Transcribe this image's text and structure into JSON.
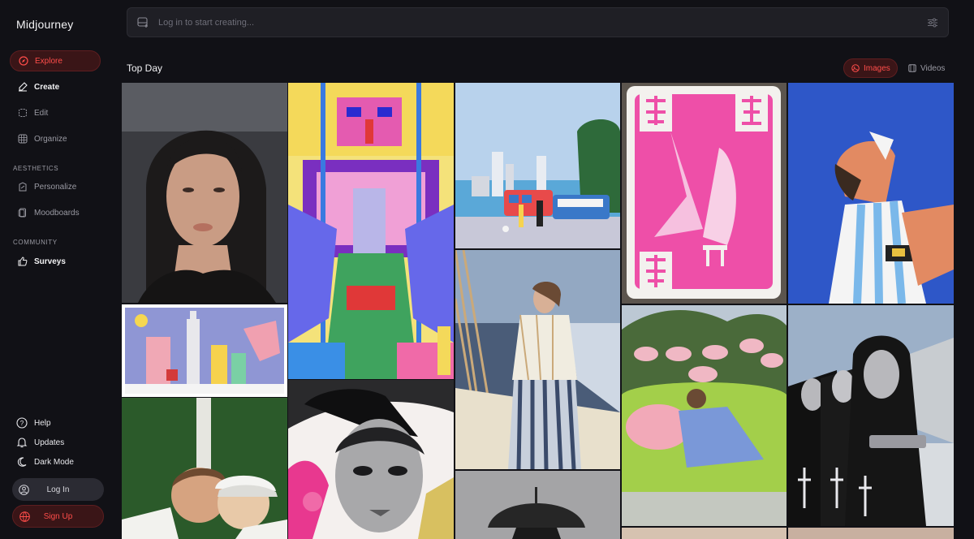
{
  "app": {
    "name": "Midjourney"
  },
  "nav": {
    "explore": "Explore",
    "create": "Create",
    "edit": "Edit",
    "organize": "Organize",
    "aesthetics_label": "AESTHETICS",
    "personalize": "Personalize",
    "moodboards": "Moodboards",
    "community_label": "COMMUNITY",
    "surveys": "Surveys"
  },
  "footer": {
    "help": "Help",
    "updates": "Updates",
    "dark_mode": "Dark Mode",
    "login": "Log In",
    "signup": "Sign Up"
  },
  "search": {
    "placeholder": "Log in to start creating..."
  },
  "feed": {
    "title": "Top Day",
    "tab_images": "Images",
    "tab_videos": "Videos"
  },
  "colors": {
    "accent": "#ff4d4a",
    "background": "#111116",
    "active_bg": "#3a1517"
  }
}
